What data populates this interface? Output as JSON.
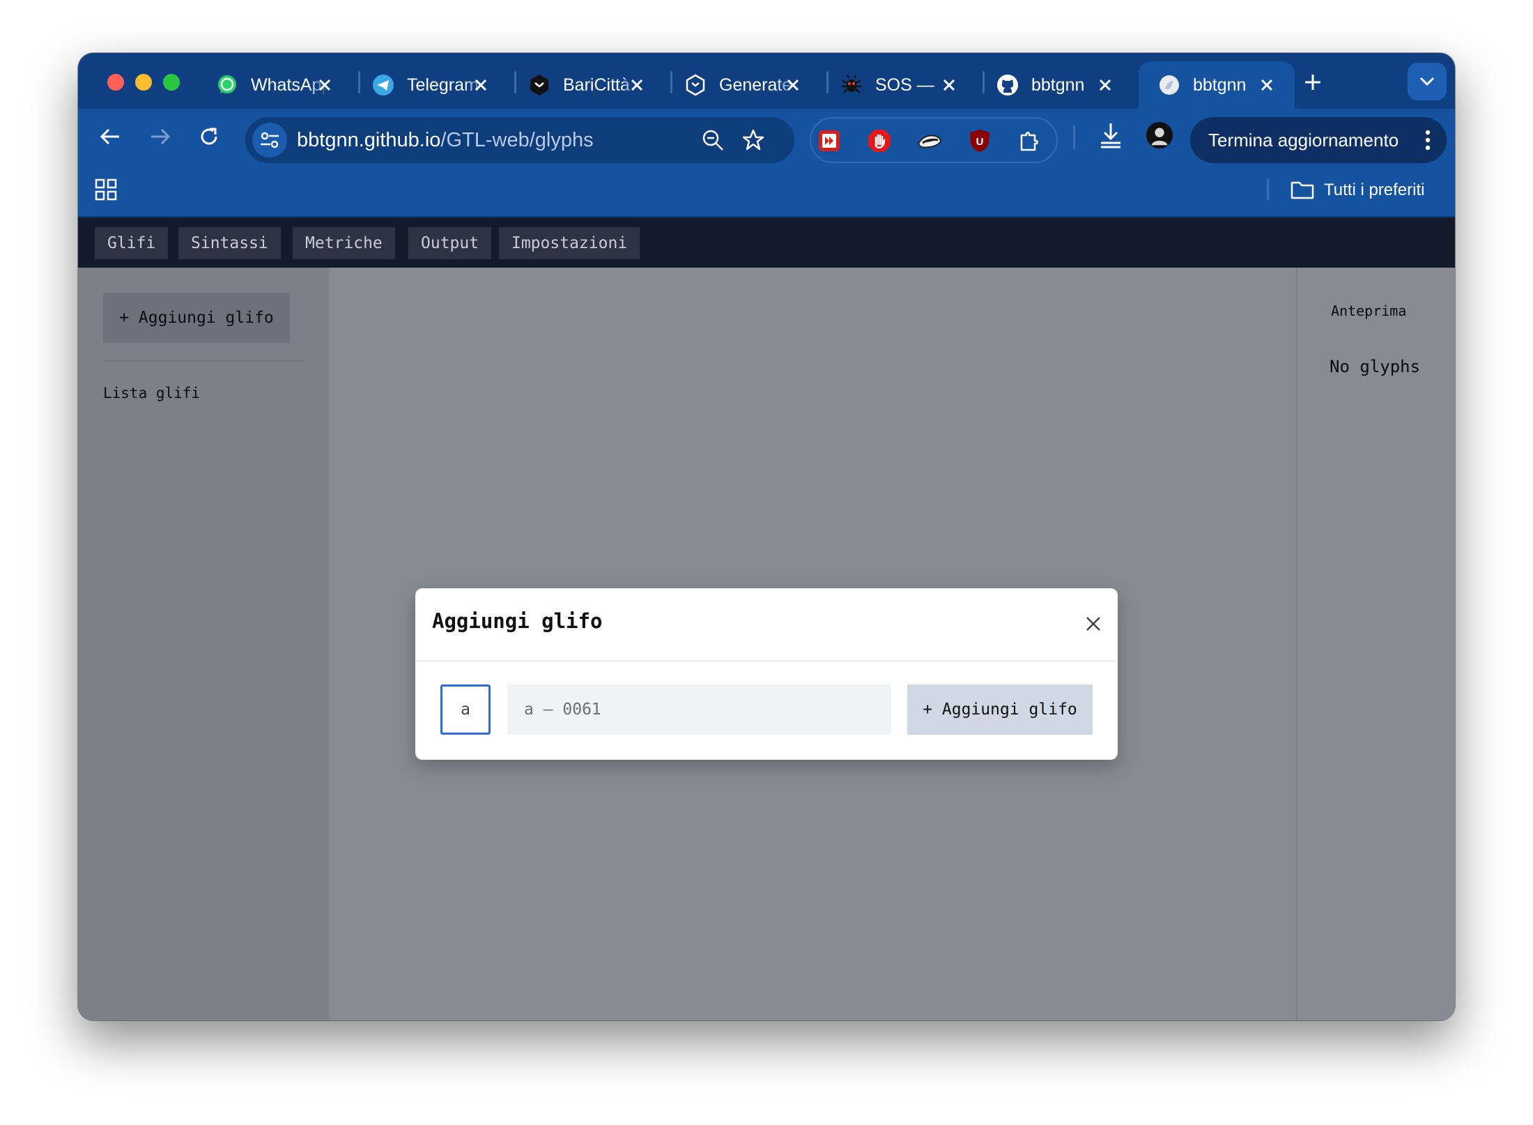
{
  "browser": {
    "tabs": [
      {
        "title": "WhatsApp",
        "icon": "whatsapp-icon",
        "active": false
      },
      {
        "title": "Telegram",
        "icon": "telegram-icon",
        "active": false
      },
      {
        "title": "BariCittà",
        "icon": "baricitta-icon",
        "active": false
      },
      {
        "title": "Generate",
        "icon": "generate-icon",
        "active": false
      },
      {
        "title": "SOS —",
        "icon": "bug-icon",
        "active": false
      },
      {
        "title": "bbtgnn",
        "icon": "github-icon",
        "active": false
      },
      {
        "title": "bbtgnn",
        "icon": "site-icon",
        "active": true
      }
    ],
    "url": {
      "host": "bbtgnn.github.io",
      "path": "/GTL-web/glyphs"
    },
    "update_button": "Termina aggiornamento",
    "bookmarks": {
      "all_label": "Tutti i preferiti"
    },
    "colors": {
      "frame": "#0f3f80",
      "toolbar": "#1553a0",
      "omnibox": "#0e3d7b"
    }
  },
  "app": {
    "nav": [
      "Glifi",
      "Sintassi",
      "Metriche",
      "Output",
      "Impostazioni"
    ],
    "sidebar": {
      "add_button": "+ Aggiungi glifo",
      "list_label": "Lista glifi"
    },
    "preview": {
      "label": "Anteprima",
      "empty": "No glyphs"
    }
  },
  "modal": {
    "title": "Aggiungi glifo",
    "char_value": "a",
    "glyph_placeholder": "a — 0061",
    "add_button": "+ Aggiungi glifo",
    "accent": "#2e6bd3"
  }
}
